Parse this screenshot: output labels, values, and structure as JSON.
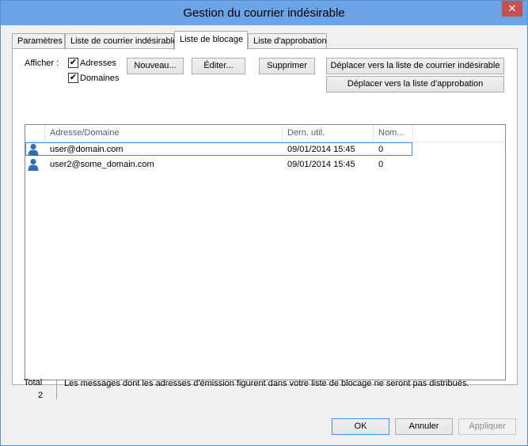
{
  "window": {
    "title": "Gestion du courrier indésirable",
    "close_glyph": "✕"
  },
  "tabs": [
    {
      "label": "Paramètres"
    },
    {
      "label": "Liste de courrier indésirable"
    },
    {
      "label": "Liste de blocage"
    },
    {
      "label": "Liste d'approbation"
    }
  ],
  "filter": {
    "label": "Afficher :",
    "addresses": {
      "label": "Adresses",
      "checked": true
    },
    "domains": {
      "label": "Domaines",
      "checked": true
    },
    "check_glyph": "✔"
  },
  "actions": {
    "new": "Nouveau...",
    "edit": "Éditer...",
    "delete": "Supprimer",
    "move_junk": "Déplacer vers la liste de courrier indésirable",
    "move_approval": "Déplacer vers la liste d'approbation"
  },
  "list": {
    "columns": [
      "Adresse/Domaine",
      "Dern. util.",
      "Nom..."
    ],
    "rows": [
      {
        "address": "user@domain.com",
        "last_used": "09/01/2014 15:45",
        "count": "0"
      },
      {
        "address": "user2@some_domain.com",
        "last_used": "09/01/2014 15:45",
        "count": "0"
      }
    ]
  },
  "footer": {
    "total_label": "Total",
    "total_value": "2",
    "info": "Les messages dont les adresses d'émission figurent dans votre  liste de blocage ne seront pas distribués."
  },
  "dialog_buttons": {
    "ok": "OK",
    "cancel": "Annuler",
    "apply": "Appliquer"
  },
  "colors": {
    "titlebar": "#6aa3e6",
    "focus": "#3399ff",
    "icon": "#2f6fb3"
  }
}
